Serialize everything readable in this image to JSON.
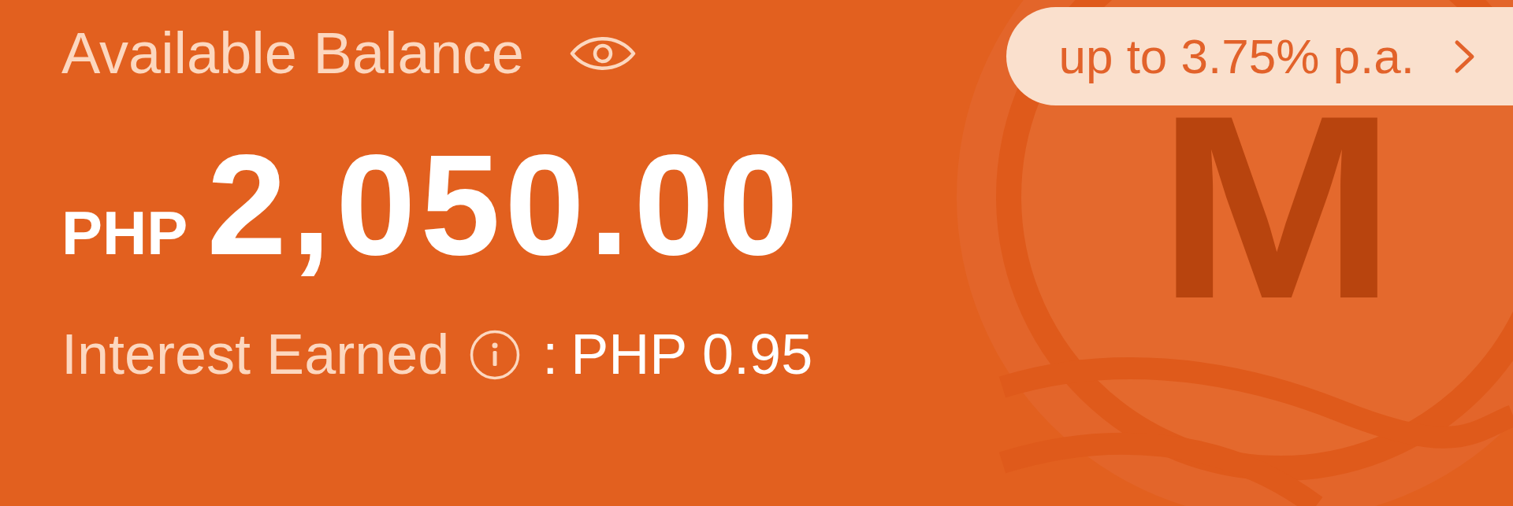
{
  "balance": {
    "label": "Available Balance",
    "currency": "PHP",
    "amount": "2,050.00"
  },
  "rate_button": {
    "label": "up to 3.75% p.a."
  },
  "interest": {
    "label": "Interest Earned",
    "separator": ":",
    "value": "PHP 0.95"
  },
  "logo": {
    "letter": "M"
  }
}
